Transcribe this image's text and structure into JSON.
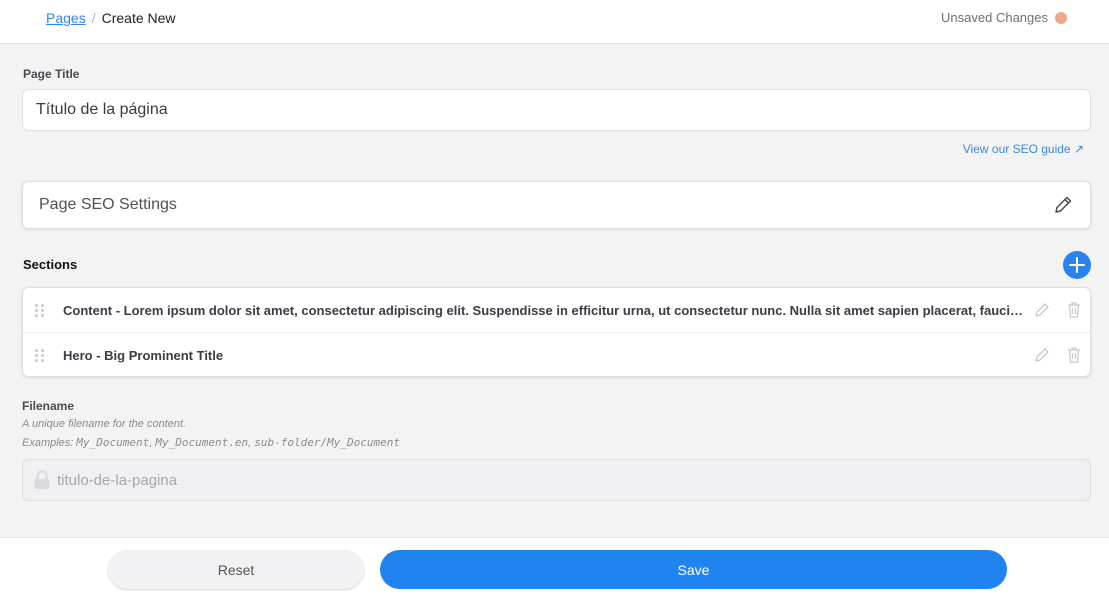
{
  "breadcrumb": {
    "parent": "Pages",
    "separator": "/",
    "current": "Create New"
  },
  "status": {
    "text": "Unsaved Changes",
    "dot_color": "#e9a98a"
  },
  "page_title": {
    "label": "Page Title",
    "value": "Título de la página"
  },
  "seo_guide_link": "View our SEO guide ↗",
  "seo_settings": {
    "label": "Page SEO Settings",
    "icon": "pencil-icon"
  },
  "sections": {
    "title": "Sections",
    "add_icon": "plus-icon",
    "items": [
      {
        "label": "Content - Lorem ipsum dolor sit amet, consectetur adipiscing elit. Suspendisse in efficitur urna, ut consectetur nunc. Nulla sit amet sapien placerat, faucibus"
      },
      {
        "label": "Hero - Big Prominent Title"
      }
    ]
  },
  "filename": {
    "label": "Filename",
    "help": "A unique filename for the content.",
    "examples_prefix": "Examples:",
    "example_1": "My_Document",
    "example_2": "My_Document.en",
    "example_3": "sub-folder/My_Document",
    "value": "titulo-de-la-pagina",
    "icon": "lock-icon"
  },
  "footer": {
    "reset_label": "Reset",
    "save_label": "Save"
  },
  "colors": {
    "accent": "#1f84f0",
    "link": "#2f86e8"
  }
}
